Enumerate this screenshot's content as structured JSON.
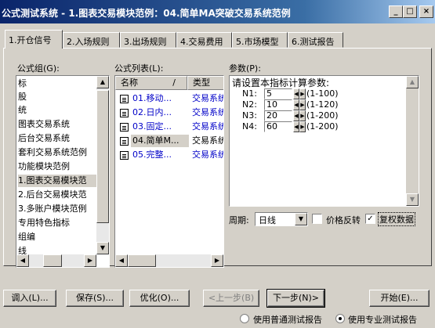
{
  "window": {
    "title": "公式测试系统 - 1.图表交易模块范例：04.简单MA突破交易系统范例"
  },
  "tabs": [
    {
      "label": "1.开仓信号"
    },
    {
      "label": "2.入场规则"
    },
    {
      "label": "3.出场规则"
    },
    {
      "label": "4.交易费用"
    },
    {
      "label": "5.市场模型"
    },
    {
      "label": "6.测试报告"
    }
  ],
  "group": {
    "label": "公式组(G):",
    "items": [
      {
        "label": "标"
      },
      {
        "label": "股"
      },
      {
        "label": "统"
      },
      {
        "label": "图表交易系统"
      },
      {
        "label": "后台交易系统"
      },
      {
        "label": "套利交易系统范例"
      },
      {
        "label": "功能模块范例"
      },
      {
        "label": "1.图表交易模块范"
      },
      {
        "label": "2.后台交易模块范"
      },
      {
        "label": "3.多账户模块范例"
      },
      {
        "label": "专用特色指标"
      },
      {
        "label": "组编"
      },
      {
        "label": "线"
      }
    ]
  },
  "formulas": {
    "label": "公式列表(L):",
    "col_name": "名称",
    "col_type": "类型",
    "rows": [
      {
        "name": "01.移动...",
        "type": "交易系统"
      },
      {
        "name": "02.日内...",
        "type": "交易系统"
      },
      {
        "name": "03.固定...",
        "type": "交易系统"
      },
      {
        "name": "04.简单M...",
        "type": "交易系统"
      },
      {
        "name": "05.完整...",
        "type": "交易系统"
      }
    ]
  },
  "params": {
    "label": "参数(P):",
    "heading": "请设置本指标计算参数:",
    "items": [
      {
        "name": "N1:",
        "value": "5",
        "range": "(1-100)"
      },
      {
        "name": "N2:",
        "value": "10",
        "range": "(1-120)"
      },
      {
        "name": "N3:",
        "value": "20",
        "range": "(1-200)"
      },
      {
        "name": "N4:",
        "value": "60",
        "range": "(1-200)"
      }
    ]
  },
  "period": {
    "label": "周期:",
    "value": "日线"
  },
  "options": {
    "reverse_label": "价格反转",
    "reverse_checked": false,
    "adjust_label": "复权数据",
    "adjust_checked": true
  },
  "buttons": {
    "import": "调入(L)...",
    "save": "保存(S)...",
    "optimize": "优化(O)...",
    "prev": "<上一步(B)",
    "next": "下一步(N)>",
    "start": "开始(E)..."
  },
  "report": {
    "normal_label": "使用普通测试报告",
    "pro_label": "使用专业测试报告",
    "selected": "pro"
  }
}
